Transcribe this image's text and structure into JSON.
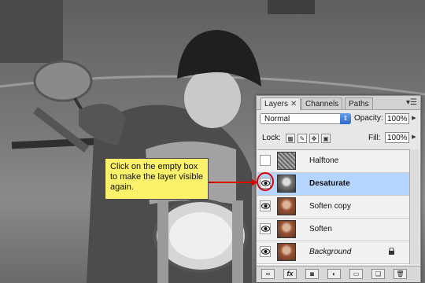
{
  "panel": {
    "tabs": [
      {
        "label": "Layers",
        "close": "✕"
      },
      {
        "label": "Channels"
      },
      {
        "label": "Paths"
      }
    ],
    "blend_mode": "Normal",
    "opacity_label": "Opacity:",
    "opacity_value": "100%",
    "lock_label": "Lock:",
    "fill_label": "Fill:",
    "fill_value": "100%",
    "layers": [
      {
        "name": "Halftone",
        "visible": false,
        "selected": false,
        "style": "normal"
      },
      {
        "name": "Desaturate",
        "visible": true,
        "selected": true,
        "style": "bold"
      },
      {
        "name": "Soften copy",
        "visible": true,
        "selected": false,
        "style": "normal"
      },
      {
        "name": "Soften",
        "visible": true,
        "selected": false,
        "style": "normal"
      },
      {
        "name": "Background",
        "visible": true,
        "selected": false,
        "style": "italic",
        "locked": true
      }
    ],
    "bottom_icons": [
      "link-icon",
      "fx-icon",
      "mask-icon",
      "adjustment-icon",
      "folder-icon",
      "new-layer-icon",
      "trash-icon"
    ],
    "bottom_labels": {
      "fx": "fx"
    }
  },
  "callout": {
    "text": "Click on the empty box to make the layer visible again."
  },
  "colors": {
    "selected_row": "#b5d5ff",
    "callout_bg": "#fbf16a",
    "highlight_red": "#d70000"
  }
}
